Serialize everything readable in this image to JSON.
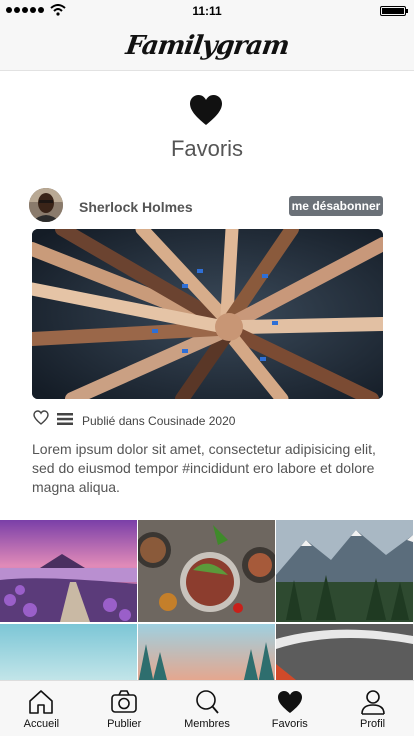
{
  "status_bar": {
    "time": "11:11"
  },
  "header": {
    "logo": "Familygram"
  },
  "page": {
    "title": "Favoris"
  },
  "post": {
    "author": "Sherlock Holmes",
    "unsubscribe_label": "me désabonner",
    "published": "Publié dans Cousinade 2020",
    "caption": "Lorem ipsum dolor sit amet, consectetur adipisicing elit, sed do eiusmod tempor #incididunt ero labore et dolore magna aliqua."
  },
  "bottom_nav": [
    {
      "label": "Accueil",
      "icon": "home-icon"
    },
    {
      "label": "Publier",
      "icon": "camera-icon"
    },
    {
      "label": "Membres",
      "icon": "search-icon"
    },
    {
      "label": "Favoris",
      "icon": "heart-icon"
    },
    {
      "label": "Profil",
      "icon": "user-icon"
    }
  ]
}
